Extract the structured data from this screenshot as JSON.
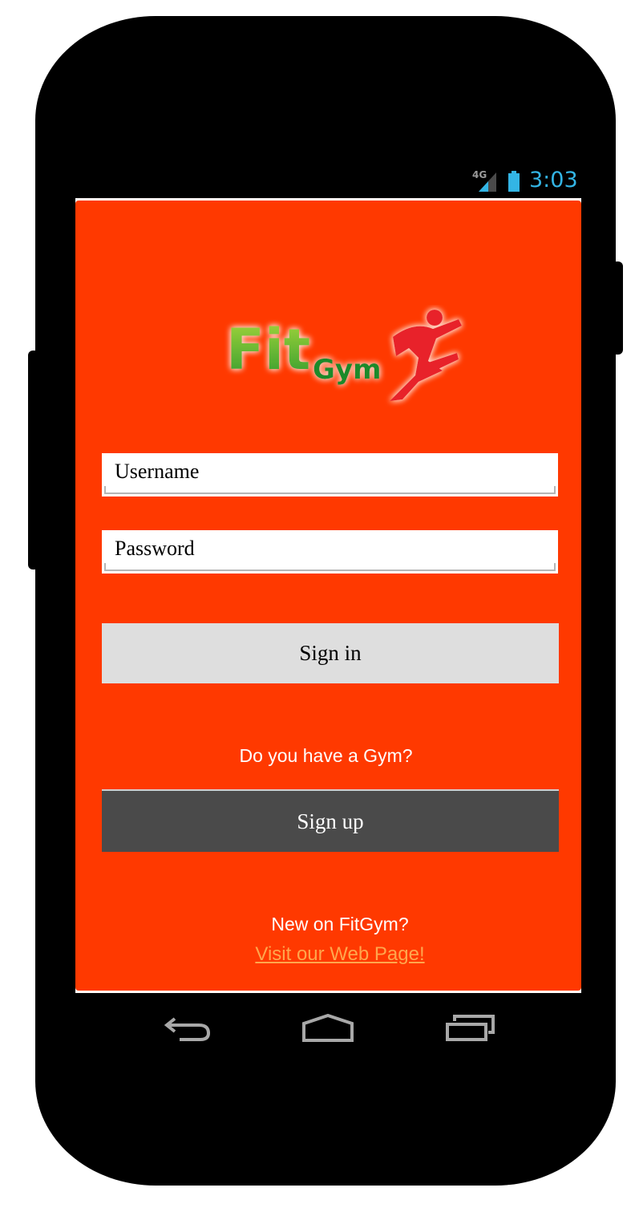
{
  "status_bar": {
    "network": "4G",
    "time": "3:03",
    "clock_color": "#33b5e5"
  },
  "app": {
    "background_color": "#ff3900",
    "logo": {
      "text_fit": "Fit",
      "text_gym": "Gym",
      "icon": "running-man-icon"
    },
    "login_form": {
      "username_placeholder": "Username",
      "password_placeholder": "Password",
      "signin_label": "Sign in"
    },
    "gym_section": {
      "question": "Do you have a Gym?",
      "signup_label": "Sign up"
    },
    "footer": {
      "new_text": "New on FitGym?",
      "link_text": "Visit our Web Page!"
    }
  },
  "nav_bar": {
    "icons": [
      "back-icon",
      "home-icon",
      "recent-apps-icon"
    ]
  }
}
